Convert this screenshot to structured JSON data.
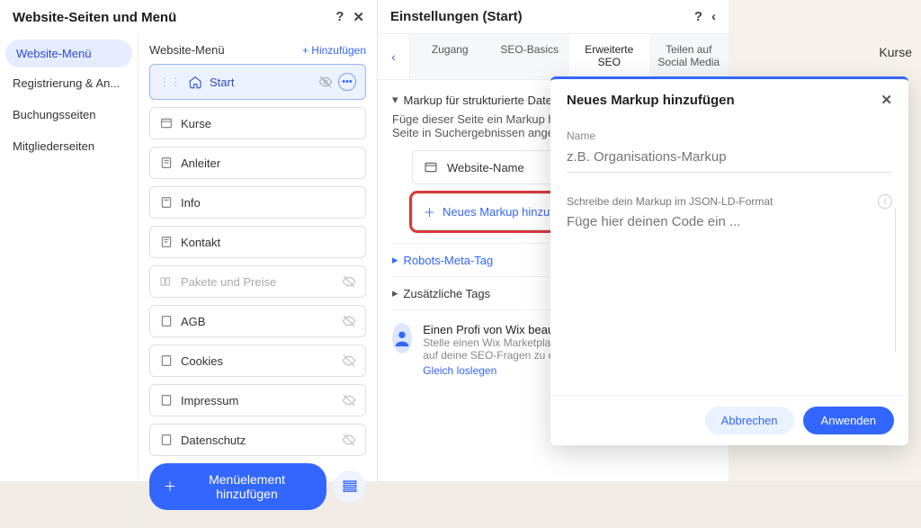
{
  "leftPanel": {
    "title": "Website-Seiten und Menü",
    "sidebar": [
      "Website-Menü",
      "Registrierung & An...",
      "Buchungsseiten",
      "Mitgliederseiten"
    ],
    "menuHeader": "Website-Menü",
    "addLink": "+  Hinzufügen",
    "pages": [
      {
        "label": "Start",
        "selected": true,
        "muted": false,
        "hidden": false
      },
      {
        "label": "Kurse",
        "selected": false,
        "muted": false,
        "hidden": false
      },
      {
        "label": "Anleiter",
        "selected": false,
        "muted": false,
        "hidden": false
      },
      {
        "label": "Info",
        "selected": false,
        "muted": false,
        "hidden": false
      },
      {
        "label": "Kontakt",
        "selected": false,
        "muted": false,
        "hidden": false
      },
      {
        "label": "Pakete und Preise",
        "selected": false,
        "muted": true,
        "hidden": true
      },
      {
        "label": "AGB",
        "selected": false,
        "muted": false,
        "hidden": true
      },
      {
        "label": "Cookies",
        "selected": false,
        "muted": false,
        "hidden": true
      },
      {
        "label": "Impressum",
        "selected": false,
        "muted": false,
        "hidden": true
      },
      {
        "label": "Datenschutz",
        "selected": false,
        "muted": false,
        "hidden": true
      }
    ],
    "addMenuBtn": "Menüelement hinzufügen"
  },
  "settingsPanel": {
    "title": "Einstellungen (Start)",
    "tabs": [
      "Zugang",
      "SEO-Basics",
      "Erweiterte SEO",
      "Teilen auf Social Media"
    ],
    "activeTab": 2,
    "markupHeader": "Markup für strukturierte Daten",
    "markupDesc": "Füge dieser Seite ein Markup hinzu und lege fest, wie deine Seite in Suchergebnissen angezeigt wird.",
    "websiteNameRow": "Website-Name",
    "addMarkup": "Neues Markup hinzufügen",
    "robots": "Robots-Meta-Tag",
    "extraTags": "Zusätzliche Tags",
    "promoTitle": "Einen Profi von Wix beauftragen",
    "promoDesc": "Stelle einen Wix Marketplace-Experten ein, um Antworten auf deine SEO-Fragen zu erhalten.",
    "promoLink": "Gleich loslegen"
  },
  "modal": {
    "title": "Neues Markup hinzufügen",
    "nameLabel": "Name",
    "namePlaceholder": "z.B. Organisations-Markup",
    "codeLabel": "Schreibe dein Markup im JSON-LD-Format",
    "codePlaceholder": "Füge hier deinen Code ein ...",
    "cancel": "Abbrechen",
    "apply": "Anwenden"
  },
  "canvas": {
    "rightHint": "Kurse"
  }
}
